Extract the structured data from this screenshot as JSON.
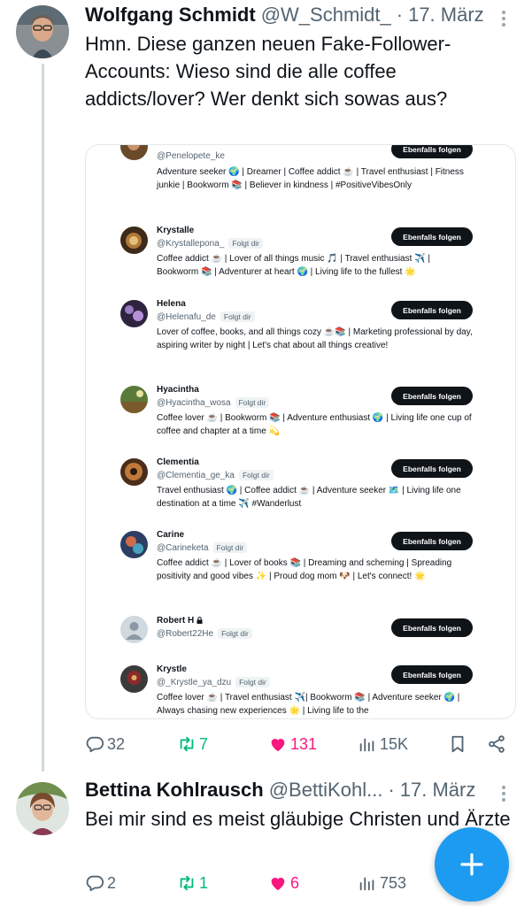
{
  "tweet1": {
    "name": "Wolfgang Schmidt",
    "handle": "@W_Schmidt_",
    "separator": "·",
    "date": "17. März",
    "text": "Hmn. Diese ganzen neuen Fake-Follower-Accounts: Wieso sind die alle coffee addicts/lover? Wer denkt sich sowas aus?",
    "media": {
      "follow_badge": "Folgt dir",
      "button_label": "Ebenfalls folgen",
      "accounts": [
        {
          "name": "",
          "handle": "@Penelopete_ke",
          "bio": "Adventure seeker 🌍 | Dreamer | Coffee addict ☕ | Travel enthusiast | Fitness junkie | Bookworm 📚 | Believer in kindness | #PositiveVibesOnly"
        },
        {
          "name": "Krystalle",
          "handle": "@Krystallepona_",
          "bio": "Coffee addict ☕ | Lover of all things music 🎵 | Travel enthusiast ✈️ | Bookworm 📚 | Adventurer at heart 🌍 | Living life to the fullest 🌟"
        },
        {
          "name": "Helena",
          "handle": "@Helenafu_de",
          "bio": "Lover of coffee, books, and all things cozy ☕📚 | Marketing professional by day, aspiring writer by night | Let's chat about all things creative!"
        },
        {
          "name": "Hyacintha",
          "handle": "@Hyacintha_wosa",
          "bio": "Coffee lover ☕ | Bookworm 📚 | Adventure enthusiast 🌍 | Living life one cup of coffee and chapter at a time 💫"
        },
        {
          "name": "Clementia",
          "handle": "@Clementia_ge_ka",
          "bio": "Travel enthusiast 🌍 | Coffee addict ☕ | Adventure seeker 🗺️ | Living life one destination at a time ✈️ #Wanderlust"
        },
        {
          "name": "Carine",
          "handle": "@Carineketa",
          "bio": "Coffee addict ☕ | Lover of books 📚 | Dreaming and scheming | Spreading positivity and good vibes ✨ | Proud dog mom 🐶 | Let's connect! 🌟"
        },
        {
          "name": "Robert H",
          "handle": "@Robert22He",
          "bio": ""
        },
        {
          "name": "Krystle",
          "handle": "@_Krystle_ya_dzu",
          "bio": "Coffee lover ☕ | Travel enthusiast ✈️| Bookworm 📚 | Adventure seeker 🌍 | Always chasing new experiences 🌟 | Living life to the"
        }
      ]
    },
    "replies": "32",
    "retweets": "7",
    "likes": "131",
    "views": "15K"
  },
  "tweet2": {
    "name": "Bettina Kohlrausch",
    "handle": "@BettiKohl...",
    "separator": "·",
    "date": "17. März",
    "text": "Bei mir sind es meist gläubige Christen und Ärzte",
    "replies": "2",
    "retweets": "1",
    "likes": "6",
    "views": "753"
  },
  "colors": {
    "accent": "#1d9bf0",
    "like": "#f91880",
    "retweet": "#00ba7c",
    "muted": "#536471"
  },
  "icons": [
    "reply-icon",
    "retweet-icon",
    "heart-icon",
    "views-icon",
    "bookmark-icon",
    "share-icon",
    "more-icon",
    "compose-plus-icon",
    "lock-icon"
  ]
}
